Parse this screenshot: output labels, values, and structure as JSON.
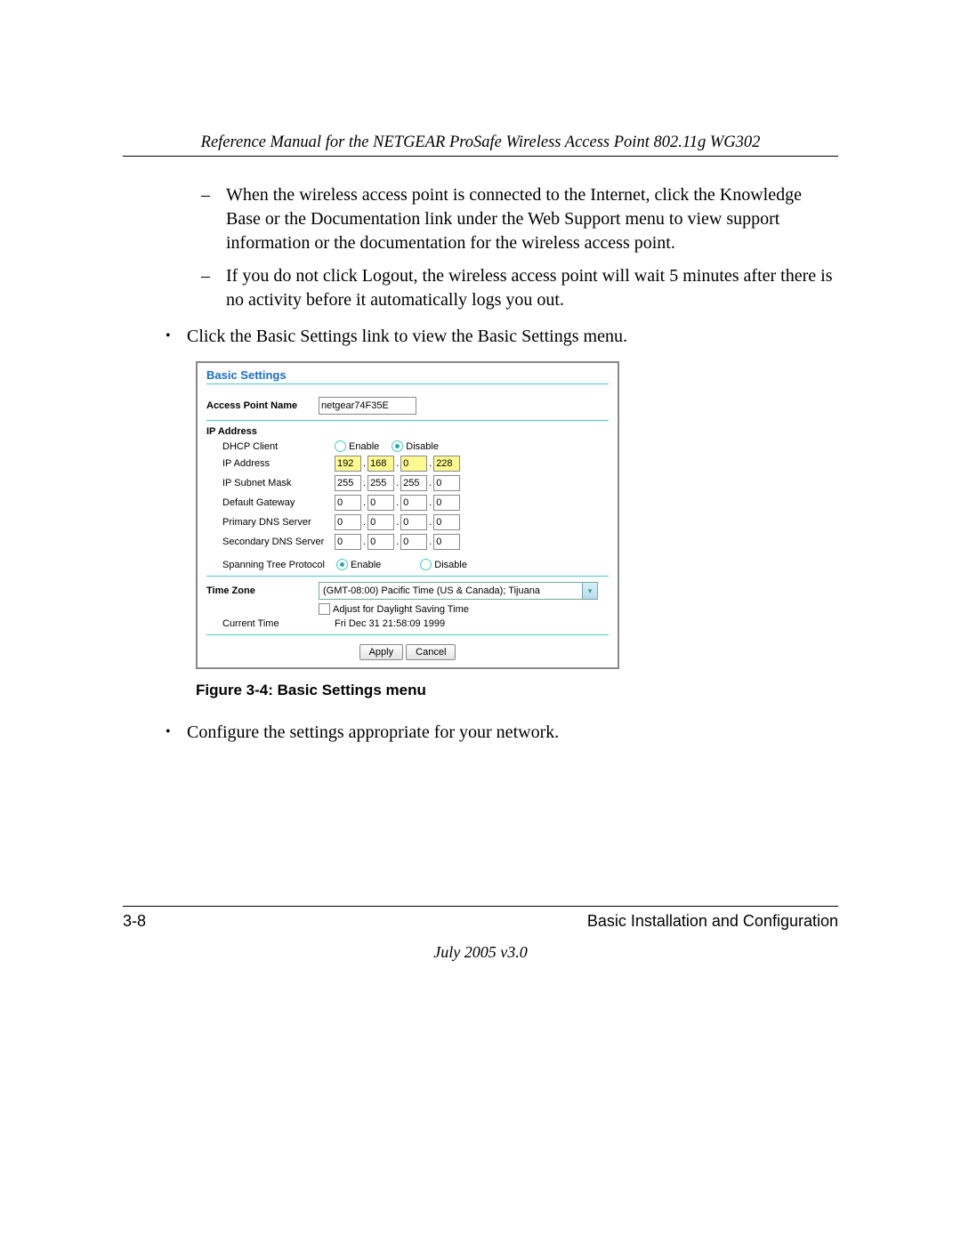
{
  "header": {
    "title": "Reference Manual for the NETGEAR ProSafe Wireless Access Point 802.11g WG302"
  },
  "content": {
    "dash1": "When the wireless access point is connected to the Internet, click the Knowledge Base or the Documentation link under the Web Support menu to view support information or the documentation for the wireless access point.",
    "dash2": "If you do not click Logout, the wireless access point will wait 5 minutes after there is no activity before it automatically logs you out.",
    "bullet1": "Click the Basic Settings link to view the Basic Settings menu.",
    "caption": "Figure 3-4: Basic Settings menu",
    "bullet2": "Configure the settings appropriate for your network."
  },
  "panel": {
    "title": "Basic Settings",
    "apName": {
      "label": "Access Point Name",
      "value": "netgear74F35E"
    },
    "ipHeading": "IP Address",
    "dhcp": {
      "label": "DHCP Client",
      "enable": "Enable",
      "disable": "Disable",
      "selected": "disable"
    },
    "ipAddress": {
      "label": "IP Address",
      "oct": [
        "192",
        "168",
        "0",
        "228"
      ]
    },
    "subnet": {
      "label": "IP Subnet Mask",
      "oct": [
        "255",
        "255",
        "255",
        "0"
      ]
    },
    "gateway": {
      "label": "Default Gateway",
      "oct": [
        "0",
        "0",
        "0",
        "0"
      ]
    },
    "dns1": {
      "label": "Primary DNS Server",
      "oct": [
        "0",
        "0",
        "0",
        "0"
      ]
    },
    "dns2": {
      "label": "Secondary DNS Server",
      "oct": [
        "0",
        "0",
        "0",
        "0"
      ]
    },
    "stp": {
      "label": "Spanning Tree Protocol",
      "enable": "Enable",
      "disable": "Disable",
      "selected": "enable"
    },
    "tz": {
      "label": "Time Zone",
      "value": "(GMT-08:00) Pacific Time (US & Canada); Tijuana"
    },
    "dst": {
      "label": "Adjust for Daylight Saving Time",
      "checked": false
    },
    "currentTime": {
      "label": "Current Time",
      "value": "Fri Dec 31 21:58:09 1999"
    },
    "buttons": {
      "apply": "Apply",
      "cancel": "Cancel"
    }
  },
  "footer": {
    "pageNum": "3-8",
    "section": "Basic Installation and Configuration",
    "date": "July 2005 v3.0"
  }
}
